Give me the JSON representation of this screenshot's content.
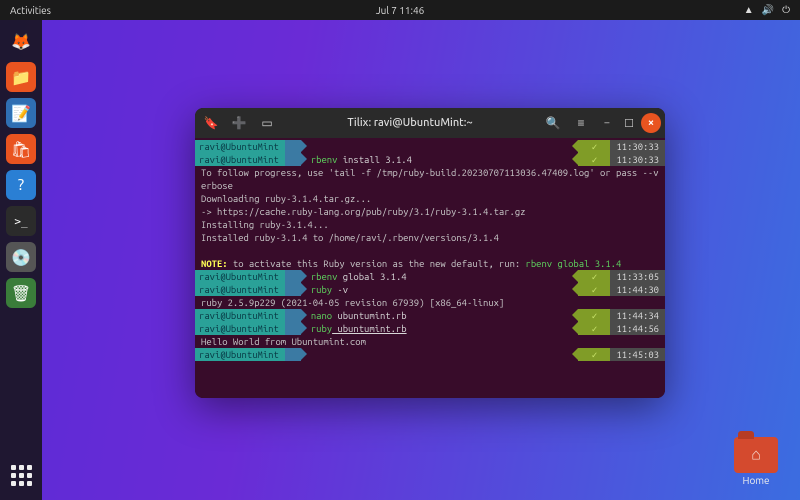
{
  "topbar": {
    "activities": "Activities",
    "clock": "Jul 7  11:46"
  },
  "dock": {
    "items": [
      {
        "name": "firefox",
        "glyph": "🦊",
        "bg": "transparent"
      },
      {
        "name": "files",
        "glyph": "📁",
        "bg": "#e95420"
      },
      {
        "name": "text-editor",
        "glyph": "📝",
        "bg": "#2f6fb3"
      },
      {
        "name": "software",
        "glyph": "🛍",
        "bg": "#e95420"
      },
      {
        "name": "help",
        "glyph": "?",
        "bg": "#2a7fd4"
      },
      {
        "name": "terminal",
        "glyph": ">_",
        "bg": "#2b2b2b"
      },
      {
        "name": "disk",
        "glyph": "💿",
        "bg": "#555"
      },
      {
        "name": "trash",
        "glyph": "🗑",
        "bg": "#3a7d3a"
      }
    ]
  },
  "terminal": {
    "title": "Tilix: ravi@UbuntuMint:~",
    "prompt_user": "ravi@UbuntuMint",
    "prompt_path": "~",
    "lines": [
      {
        "type": "prompt",
        "cmd_bin": "",
        "cmd_rest": "",
        "time": "11:30:33"
      },
      {
        "type": "prompt",
        "cmd_bin": "rbenv",
        "cmd_rest": " install 3.1.4",
        "time": "11:30:33"
      },
      {
        "type": "out",
        "text": "To follow progress, use 'tail -f /tmp/ruby-build.20230707113036.47409.log' or pass --verbose"
      },
      {
        "type": "out",
        "text": "Downloading ruby-3.1.4.tar.gz..."
      },
      {
        "type": "out",
        "text": "-> https://cache.ruby-lang.org/pub/ruby/3.1/ruby-3.1.4.tar.gz"
      },
      {
        "type": "out",
        "text": "Installing ruby-3.1.4..."
      },
      {
        "type": "out",
        "text": "Installed ruby-3.1.4 to /home/ravi/.rbenv/versions/3.1.4"
      },
      {
        "type": "blank"
      },
      {
        "type": "note",
        "pre": "NOTE:",
        "text": " to activate this Ruby version as the new default, run: ",
        "cmd": "rbenv global 3.1.4"
      },
      {
        "type": "prompt",
        "cmd_bin": "rbenv",
        "cmd_rest": " global 3.1.4",
        "time": "11:33:05"
      },
      {
        "type": "prompt",
        "cmd_bin": "ruby",
        "cmd_rest": " -v",
        "time": "11:44:30"
      },
      {
        "type": "out",
        "text": "ruby 2.5.9p229 (2021-04-05 revision 67939) [x86_64-linux]"
      },
      {
        "type": "prompt",
        "cmd_bin": "nano",
        "cmd_rest": " ubuntumint.rb",
        "time": "11:44:34"
      },
      {
        "type": "prompt",
        "cmd_bin": "ruby",
        "cmd_rest_ul": " ubuntumint.rb",
        "time": "11:44:56"
      },
      {
        "type": "out",
        "text": "Hello World from Ubuntumint.com"
      },
      {
        "type": "prompt",
        "cmd_bin": "",
        "cmd_rest": "",
        "time": "11:45:03"
      }
    ]
  },
  "desktop": {
    "home_label": "Home"
  }
}
